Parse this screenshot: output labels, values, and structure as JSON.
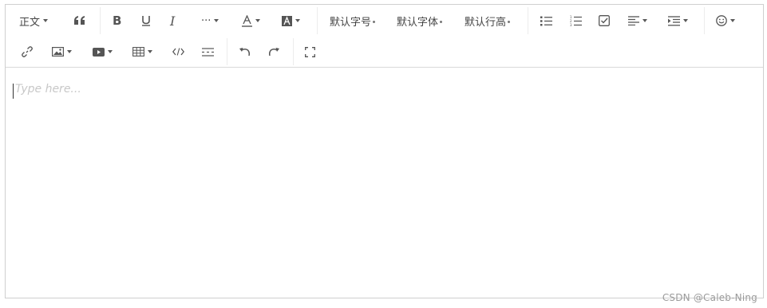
{
  "toolbar": {
    "paragraph_label": "正文",
    "fontsize_label": "默认字号",
    "fontfamily_label": "默认字体",
    "lineheight_label": "默认行高",
    "more_label": "···"
  },
  "editor": {
    "placeholder": "Type here..."
  },
  "watermark": "CSDN @Caleb-Ning",
  "colors": {
    "icon": "#595959",
    "border": "#cfcfcf",
    "placeholder": "#c8c8c8"
  }
}
